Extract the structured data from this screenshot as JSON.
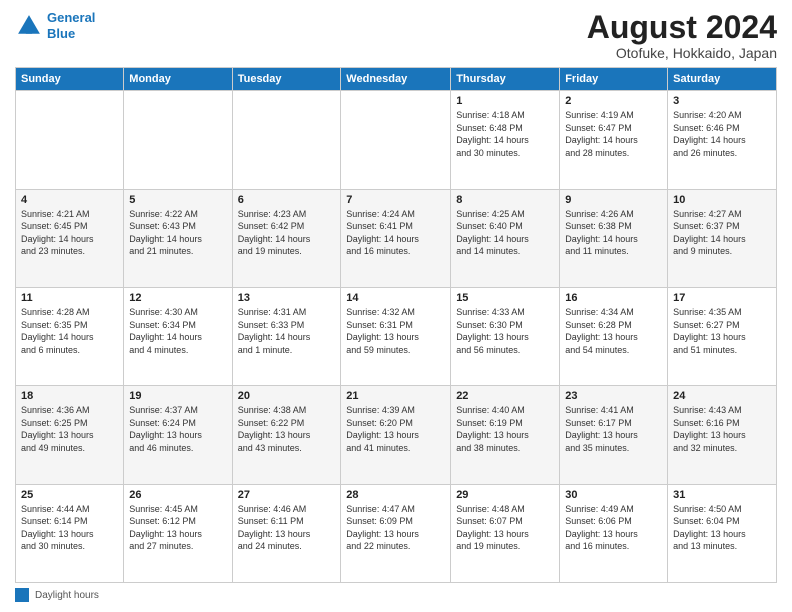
{
  "header": {
    "logo_line1": "General",
    "logo_line2": "Blue",
    "main_title": "August 2024",
    "subtitle": "Otofuke, Hokkaido, Japan"
  },
  "calendar": {
    "days_of_week": [
      "Sunday",
      "Monday",
      "Tuesday",
      "Wednesday",
      "Thursday",
      "Friday",
      "Saturday"
    ],
    "weeks": [
      [
        {
          "day": "",
          "info": ""
        },
        {
          "day": "",
          "info": ""
        },
        {
          "day": "",
          "info": ""
        },
        {
          "day": "",
          "info": ""
        },
        {
          "day": "1",
          "info": "Sunrise: 4:18 AM\nSunset: 6:48 PM\nDaylight: 14 hours\nand 30 minutes."
        },
        {
          "day": "2",
          "info": "Sunrise: 4:19 AM\nSunset: 6:47 PM\nDaylight: 14 hours\nand 28 minutes."
        },
        {
          "day": "3",
          "info": "Sunrise: 4:20 AM\nSunset: 6:46 PM\nDaylight: 14 hours\nand 26 minutes."
        }
      ],
      [
        {
          "day": "4",
          "info": "Sunrise: 4:21 AM\nSunset: 6:45 PM\nDaylight: 14 hours\nand 23 minutes."
        },
        {
          "day": "5",
          "info": "Sunrise: 4:22 AM\nSunset: 6:43 PM\nDaylight: 14 hours\nand 21 minutes."
        },
        {
          "day": "6",
          "info": "Sunrise: 4:23 AM\nSunset: 6:42 PM\nDaylight: 14 hours\nand 19 minutes."
        },
        {
          "day": "7",
          "info": "Sunrise: 4:24 AM\nSunset: 6:41 PM\nDaylight: 14 hours\nand 16 minutes."
        },
        {
          "day": "8",
          "info": "Sunrise: 4:25 AM\nSunset: 6:40 PM\nDaylight: 14 hours\nand 14 minutes."
        },
        {
          "day": "9",
          "info": "Sunrise: 4:26 AM\nSunset: 6:38 PM\nDaylight: 14 hours\nand 11 minutes."
        },
        {
          "day": "10",
          "info": "Sunrise: 4:27 AM\nSunset: 6:37 PM\nDaylight: 14 hours\nand 9 minutes."
        }
      ],
      [
        {
          "day": "11",
          "info": "Sunrise: 4:28 AM\nSunset: 6:35 PM\nDaylight: 14 hours\nand 6 minutes."
        },
        {
          "day": "12",
          "info": "Sunrise: 4:30 AM\nSunset: 6:34 PM\nDaylight: 14 hours\nand 4 minutes."
        },
        {
          "day": "13",
          "info": "Sunrise: 4:31 AM\nSunset: 6:33 PM\nDaylight: 14 hours\nand 1 minute."
        },
        {
          "day": "14",
          "info": "Sunrise: 4:32 AM\nSunset: 6:31 PM\nDaylight: 13 hours\nand 59 minutes."
        },
        {
          "day": "15",
          "info": "Sunrise: 4:33 AM\nSunset: 6:30 PM\nDaylight: 13 hours\nand 56 minutes."
        },
        {
          "day": "16",
          "info": "Sunrise: 4:34 AM\nSunset: 6:28 PM\nDaylight: 13 hours\nand 54 minutes."
        },
        {
          "day": "17",
          "info": "Sunrise: 4:35 AM\nSunset: 6:27 PM\nDaylight: 13 hours\nand 51 minutes."
        }
      ],
      [
        {
          "day": "18",
          "info": "Sunrise: 4:36 AM\nSunset: 6:25 PM\nDaylight: 13 hours\nand 49 minutes."
        },
        {
          "day": "19",
          "info": "Sunrise: 4:37 AM\nSunset: 6:24 PM\nDaylight: 13 hours\nand 46 minutes."
        },
        {
          "day": "20",
          "info": "Sunrise: 4:38 AM\nSunset: 6:22 PM\nDaylight: 13 hours\nand 43 minutes."
        },
        {
          "day": "21",
          "info": "Sunrise: 4:39 AM\nSunset: 6:20 PM\nDaylight: 13 hours\nand 41 minutes."
        },
        {
          "day": "22",
          "info": "Sunrise: 4:40 AM\nSunset: 6:19 PM\nDaylight: 13 hours\nand 38 minutes."
        },
        {
          "day": "23",
          "info": "Sunrise: 4:41 AM\nSunset: 6:17 PM\nDaylight: 13 hours\nand 35 minutes."
        },
        {
          "day": "24",
          "info": "Sunrise: 4:43 AM\nSunset: 6:16 PM\nDaylight: 13 hours\nand 32 minutes."
        }
      ],
      [
        {
          "day": "25",
          "info": "Sunrise: 4:44 AM\nSunset: 6:14 PM\nDaylight: 13 hours\nand 30 minutes."
        },
        {
          "day": "26",
          "info": "Sunrise: 4:45 AM\nSunset: 6:12 PM\nDaylight: 13 hours\nand 27 minutes."
        },
        {
          "day": "27",
          "info": "Sunrise: 4:46 AM\nSunset: 6:11 PM\nDaylight: 13 hours\nand 24 minutes."
        },
        {
          "day": "28",
          "info": "Sunrise: 4:47 AM\nSunset: 6:09 PM\nDaylight: 13 hours\nand 22 minutes."
        },
        {
          "day": "29",
          "info": "Sunrise: 4:48 AM\nSunset: 6:07 PM\nDaylight: 13 hours\nand 19 minutes."
        },
        {
          "day": "30",
          "info": "Sunrise: 4:49 AM\nSunset: 6:06 PM\nDaylight: 13 hours\nand 16 minutes."
        },
        {
          "day": "31",
          "info": "Sunrise: 4:50 AM\nSunset: 6:04 PM\nDaylight: 13 hours\nand 13 minutes."
        }
      ]
    ]
  },
  "footer": {
    "label": "Daylight hours"
  }
}
